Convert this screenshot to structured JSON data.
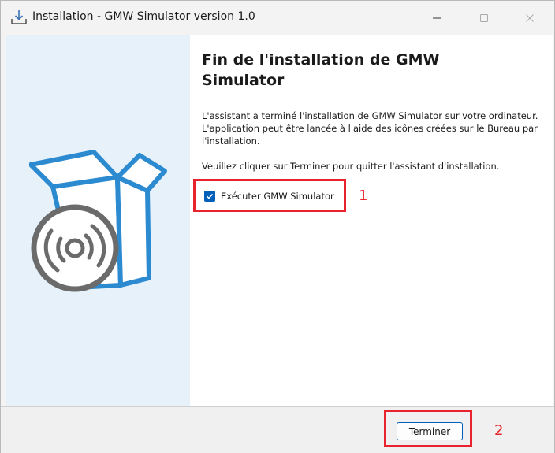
{
  "window": {
    "title": "Installation - GMW Simulator version 1.0",
    "icons": {
      "app": "download-installer-icon",
      "minimize": "minimize-icon",
      "maximize": "maximize-icon",
      "close": "close-icon"
    }
  },
  "left_panel": {
    "illustration": "software-box-with-disc-icon"
  },
  "content": {
    "heading": "Fin de l'installation de GMW Simulator",
    "paragraph1": "L'assistant a terminé l'installation de GMW Simulator sur votre ordinateur. L'application peut être lancée à l'aide des icônes créées sur le Bureau par l'installation.",
    "paragraph2": "Veuillez cliquer sur Terminer pour quitter l'assistant d'installation.",
    "run_option": {
      "label": "Exécuter GMW Simulator",
      "checked": true
    }
  },
  "footer": {
    "finish_label": "Terminer"
  },
  "annotations": {
    "marker1": "1",
    "marker2": "2",
    "color": "#e8232b"
  },
  "colors": {
    "accent": "#005fb8",
    "panel_bg": "#e6f1f9",
    "illustration_blue": "#2b8ad0",
    "disc_gray": "#6b6b6b"
  }
}
